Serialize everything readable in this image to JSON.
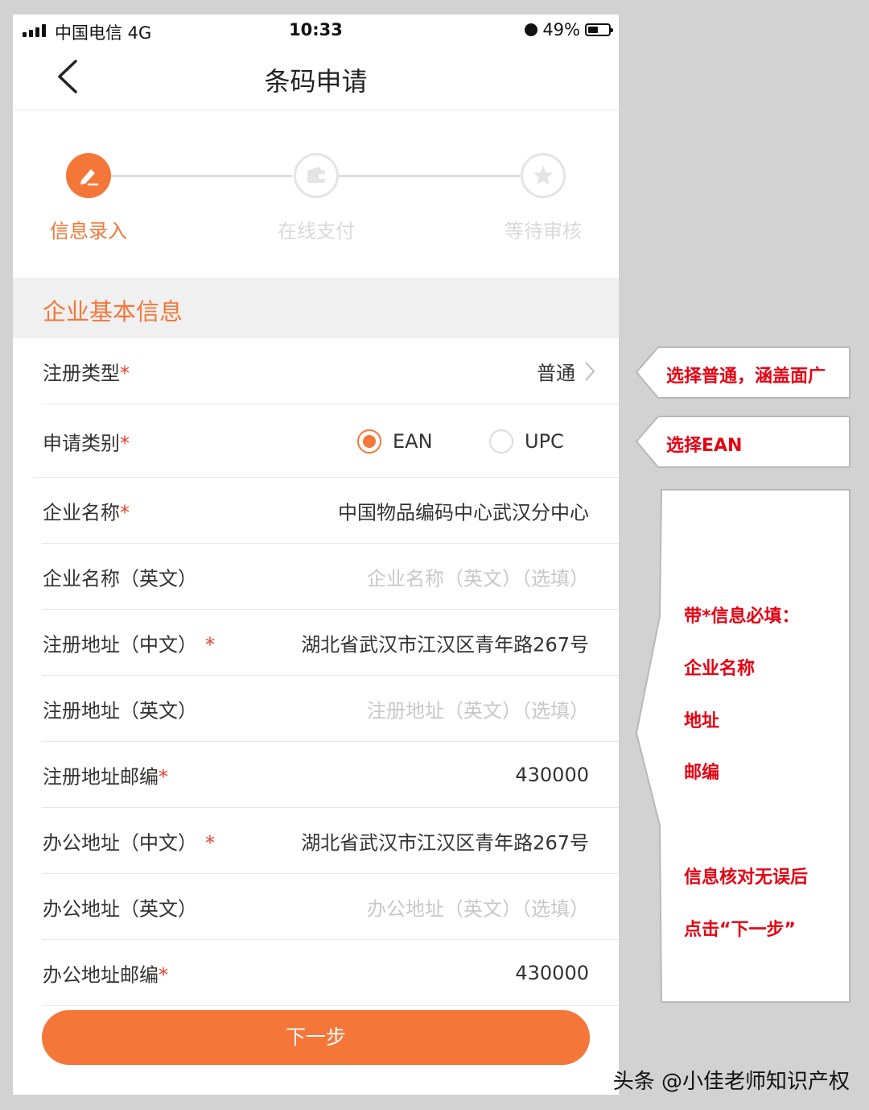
{
  "status_bar": {
    "carrier": "中国电信  4G",
    "time": "10:33",
    "battery": "49%",
    "battery_level": 0.49
  },
  "nav": {
    "title": "条码申请"
  },
  "steps": [
    {
      "label": "信息录入",
      "state": "active"
    },
    {
      "label": "在线支付",
      "state": "pending"
    },
    {
      "label": "等待审核",
      "state": "pending"
    }
  ],
  "section_title": "企业基本信息",
  "form": {
    "reg_type": {
      "label": "注册类型",
      "required": "*",
      "value": "普通"
    },
    "apply_type": {
      "label": "申请类别",
      "required": "*",
      "options": [
        "EAN",
        "UPC"
      ],
      "selected": "EAN"
    },
    "company_name": {
      "label": "企业名称",
      "required": "*",
      "value": "中国物品编码中心武汉分中心"
    },
    "company_name_en": {
      "label": "企业名称（英文）",
      "placeholder": "企业名称（英文）（选填）"
    },
    "reg_addr_cn": {
      "label": "注册地址（中文）",
      "required": "*",
      "value": "湖北省武汉市江汉区青年路267号"
    },
    "reg_addr_en": {
      "label": "注册地址（英文）",
      "placeholder": "注册地址（英文）（选填）"
    },
    "reg_zip": {
      "label": "注册地址邮编",
      "required": "*",
      "value": "430000"
    },
    "office_addr_cn": {
      "label": "办公地址（中文）",
      "required": "*",
      "value": "湖北省武汉市江汉区青年路267号"
    },
    "office_addr_en": {
      "label": "办公地址（英文）",
      "placeholder": "办公地址（英文）（选填）"
    },
    "office_zip": {
      "label": "办公地址邮编",
      "required": "*",
      "value": "430000"
    }
  },
  "next_button": "下一步",
  "annotations": {
    "callout1": "选择普通，涵盖面广",
    "callout2": "选择EAN",
    "notes": [
      "带*信息必填：",
      "企业名称",
      "地址",
      "邮编",
      "信息核对无误后",
      "点击“下一步”"
    ]
  },
  "watermark": "头条 @小佳老师知识产权",
  "colors": {
    "accent": "#f47638",
    "annotation": "#e60012",
    "required": "#e8402f"
  }
}
